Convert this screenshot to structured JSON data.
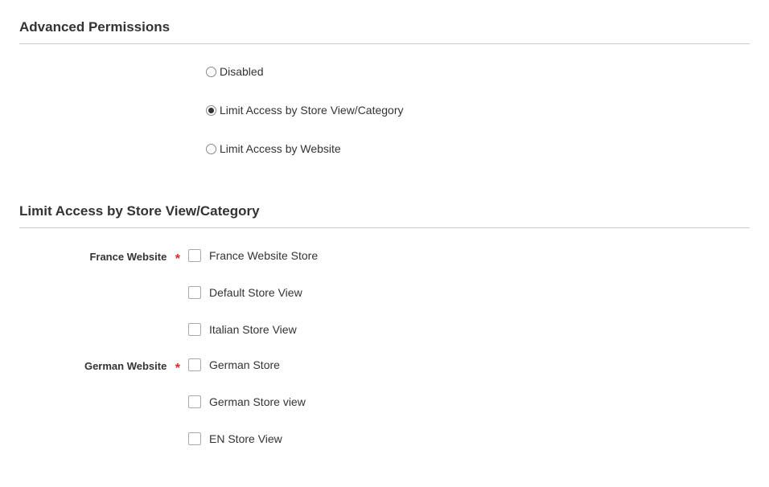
{
  "section1": {
    "title": "Advanced Permissions",
    "radios": [
      {
        "label": "Disabled",
        "selected": false
      },
      {
        "label": "Limit Access by Store View/Category",
        "selected": true
      },
      {
        "label": "Limit Access by Website",
        "selected": false
      }
    ]
  },
  "section2": {
    "title": "Limit Access by Store View/Category",
    "groups": [
      {
        "label": "France Website",
        "required": true,
        "checkboxes": [
          {
            "label": "France Website Store",
            "checked": false
          },
          {
            "label": "Default Store View",
            "checked": false
          },
          {
            "label": "Italian Store View",
            "checked": false
          }
        ]
      },
      {
        "label": "German Website",
        "required": true,
        "checkboxes": [
          {
            "label": "German Store",
            "checked": false
          },
          {
            "label": "German Store view",
            "checked": false
          },
          {
            "label": "EN Store View",
            "checked": false
          }
        ]
      }
    ]
  }
}
